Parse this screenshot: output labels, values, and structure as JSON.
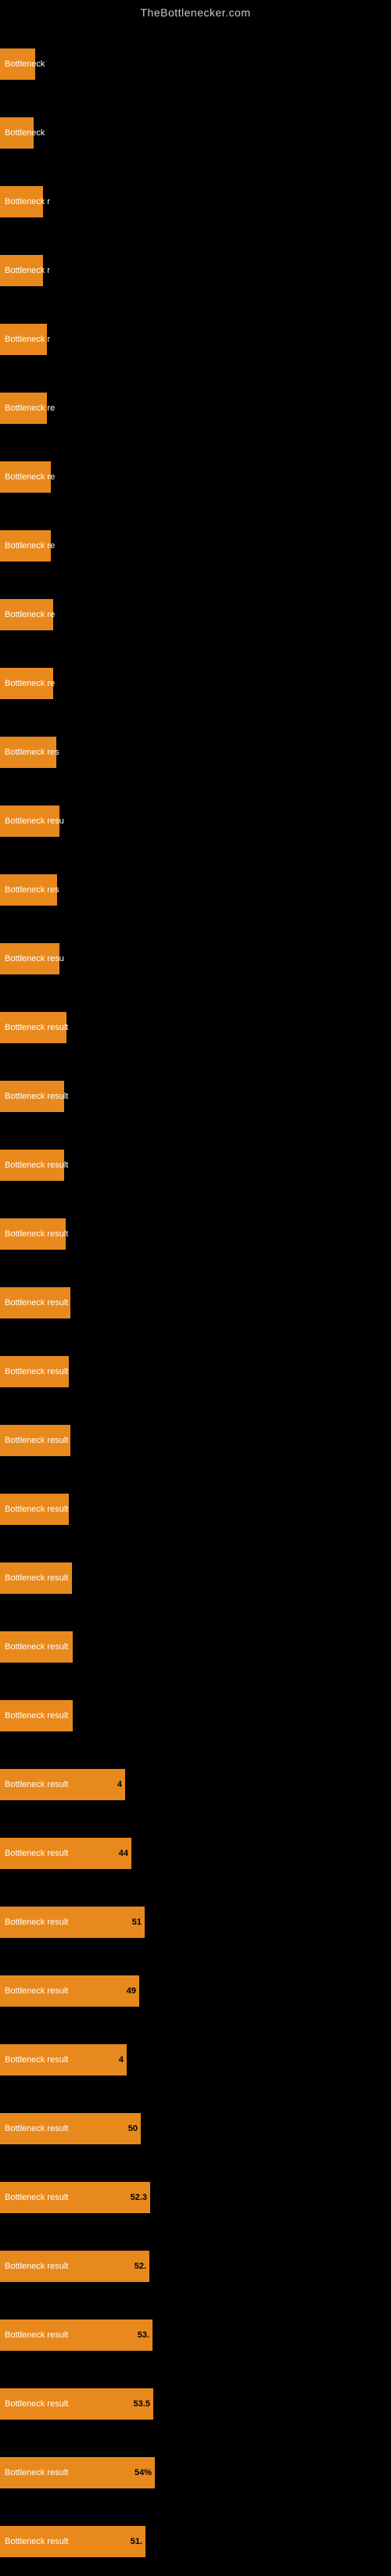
{
  "site_title": "TheBottlenecker.com",
  "bars": [
    {
      "label": "Bottleneck",
      "value": "",
      "width": 45
    },
    {
      "label": "Bottleneck",
      "value": "",
      "width": 43
    },
    {
      "label": "Bottleneck r",
      "value": "",
      "width": 55
    },
    {
      "label": "Bottleneck r",
      "value": "",
      "width": 55
    },
    {
      "label": "Bottleneck r",
      "value": "",
      "width": 60
    },
    {
      "label": "Bottleneck re",
      "value": "",
      "width": 60
    },
    {
      "label": "Bottleneck re",
      "value": "",
      "width": 65
    },
    {
      "label": "Bottleneck re",
      "value": "",
      "width": 65
    },
    {
      "label": "Bottleneck re",
      "value": "",
      "width": 68
    },
    {
      "label": "Bottleneck re",
      "value": "",
      "width": 68
    },
    {
      "label": "Bottleneck res",
      "value": "",
      "width": 72
    },
    {
      "label": "Bottleneck resu",
      "value": "",
      "width": 76
    },
    {
      "label": "Bottleneck res",
      "value": "",
      "width": 73
    },
    {
      "label": "Bottleneck resu",
      "value": "",
      "width": 76
    },
    {
      "label": "Bottleneck result",
      "value": "",
      "width": 85
    },
    {
      "label": "Bottleneck result",
      "value": "",
      "width": 82
    },
    {
      "label": "Bottleneck result",
      "value": "",
      "width": 82
    },
    {
      "label": "Bottleneck result",
      "value": "",
      "width": 84
    },
    {
      "label": "Bottleneck result",
      "value": "",
      "width": 90
    },
    {
      "label": "Bottleneck result",
      "value": "",
      "width": 88
    },
    {
      "label": "Bottleneck result",
      "value": "",
      "width": 90
    },
    {
      "label": "Bottleneck result",
      "value": "",
      "width": 88
    },
    {
      "label": "Bottleneck result",
      "value": "",
      "width": 92
    },
    {
      "label": "Bottleneck result",
      "value": "",
      "width": 93
    },
    {
      "label": "Bottleneck result",
      "value": "",
      "width": 93
    },
    {
      "label": "Bottleneck result",
      "value": "4",
      "width": 160
    },
    {
      "label": "Bottleneck result",
      "value": "44",
      "width": 168
    },
    {
      "label": "Bottleneck result",
      "value": "51",
      "width": 185
    },
    {
      "label": "Bottleneck result",
      "value": "49",
      "width": 178
    },
    {
      "label": "Bottleneck result",
      "value": "4",
      "width": 162
    },
    {
      "label": "Bottleneck result",
      "value": "50",
      "width": 180
    },
    {
      "label": "Bottleneck result",
      "value": "52.3",
      "width": 192
    },
    {
      "label": "Bottleneck result",
      "value": "52.",
      "width": 191
    },
    {
      "label": "Bottleneck result",
      "value": "53.",
      "width": 195
    },
    {
      "label": "Bottleneck result",
      "value": "53.5",
      "width": 196
    },
    {
      "label": "Bottleneck result",
      "value": "54%",
      "width": 198
    },
    {
      "label": "Bottleneck result",
      "value": "51.",
      "width": 186
    }
  ]
}
